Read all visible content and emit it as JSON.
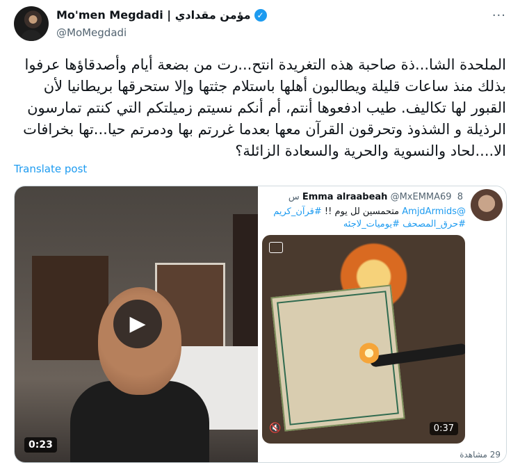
{
  "author": {
    "display_name": "Mo'men Megdadi | مؤمن مقدادي",
    "handle": "@MoMegdadi"
  },
  "more_icon": "more-icon",
  "tweet": {
    "text": "الملحدة الشا...ذة صاحبة هذه التغريدة انتح...رت من بضعة أيام وأصدقاؤها عرفوا بذلك منذ ساعات قليلة ويطالبون أهلها باستلام جثتها وإلا ستحرقها بريطانيا لأن القبور لها تكاليف. طيب ادفعوها أنتم، أم أنكم نسيتم زميلتكم التي كنتم تمارسون الرذيلة و الشذوذ وتحرقون القرآن معها بعدما غررتم بها ودمرتم حيا...تها بخرافات  الا....لحاد والنسوية والحرية والسعادة الزائلة؟",
    "translate_label": "Translate post"
  },
  "media": {
    "left_video": {
      "duration": "0:23"
    },
    "embedded_post": {
      "name": "Emma alraabeah",
      "handle": "@MxEMMA69",
      "time": "8 س",
      "mention": "@AmjdArmids",
      "text_main": "متحمسين لل يوم !!",
      "hashtags": "#قرآن_كريم #حرق_المصحف #يوميات_لاجئه",
      "duration": "0:37",
      "views": "29 مشاهدة"
    }
  }
}
